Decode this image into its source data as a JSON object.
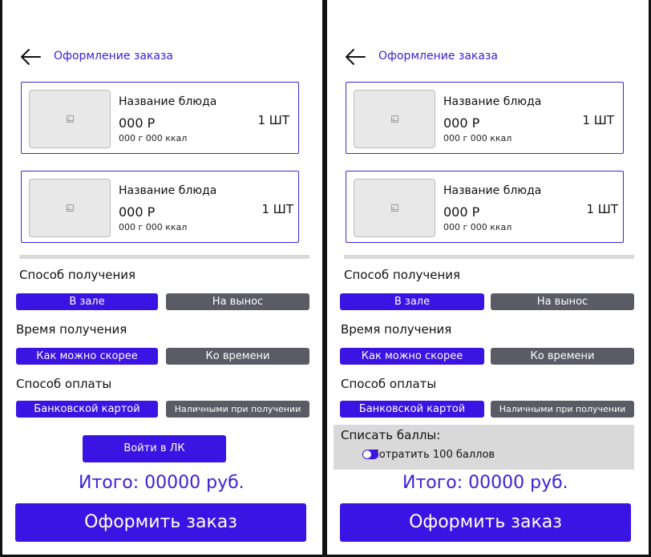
{
  "header": {
    "title": "Оформление заказа"
  },
  "cart": {
    "items": [
      {
        "name": "Название блюда",
        "price": "000 Р",
        "meta": "000 г 000 ккал",
        "qty": "1 ШТ"
      },
      {
        "name": "Название блюда",
        "price": "000 Р",
        "meta": "000 г 000 ккал",
        "qty": "1 ШТ"
      }
    ]
  },
  "delivery": {
    "label": "Способ получения",
    "options": [
      "В зале",
      "На вынос"
    ],
    "selected": "В зале"
  },
  "time": {
    "label": "Время получения",
    "options": [
      "Как можно скорее",
      "Ко времени"
    ],
    "selected": "Как можно скорее"
  },
  "payment": {
    "label": "Способ оплаты",
    "options": [
      "Банковской картой",
      "Наличными при получении"
    ],
    "selected": "Банковской картой"
  },
  "login_button": "Войти в ЛК",
  "points": {
    "label": "Списать баллы:",
    "toggle_text": "Потратить 100 баллов",
    "enabled": true
  },
  "total": "Итого: 00000 руб.",
  "order_button": "Оформить заказ",
  "colors": {
    "accent": "#3a14e2",
    "inactive": "#5b5b66",
    "divider": "#d9d9d9"
  }
}
